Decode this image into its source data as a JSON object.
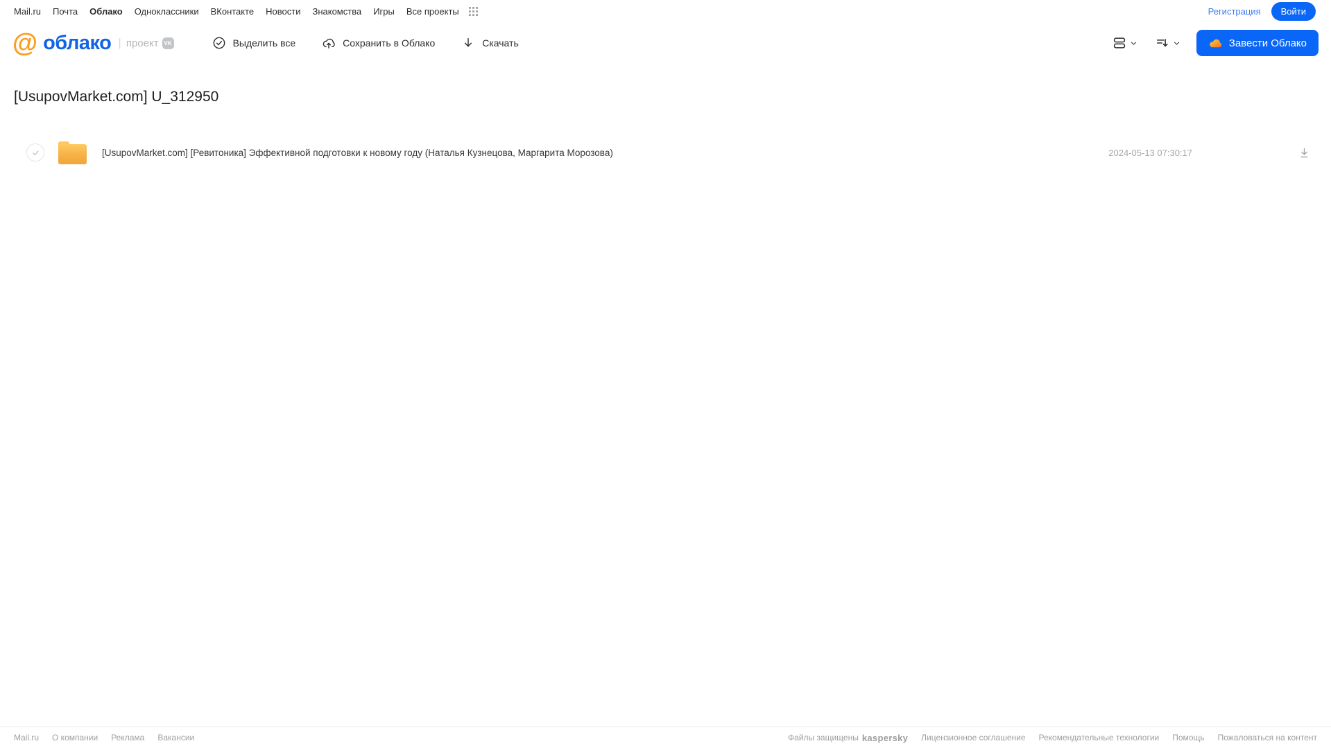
{
  "topbar": {
    "links": [
      "Mail.ru",
      "Почта",
      "Облако",
      "Одноклассники",
      "ВКонтакте",
      "Новости",
      "Знакомства",
      "Игры",
      "Все проекты"
    ],
    "active_link": "Облако",
    "register": "Регистрация",
    "login": "Войти"
  },
  "header": {
    "at_symbol": "@",
    "brand": "облако",
    "project_label": "проект",
    "vk_badge": "VK",
    "actions": [
      {
        "label": "Выделить все",
        "icon": "check-circle-icon"
      },
      {
        "label": "Сохранить в Облако",
        "icon": "cloud-upload-icon"
      },
      {
        "label": "Скачать",
        "icon": "download-icon"
      }
    ],
    "get_cloud": "Завести Облако"
  },
  "main": {
    "title": "[UsupovMarket.com] U_312950",
    "files": [
      {
        "type": "folder",
        "name": "[UsupovMarket.com] [Ревитоника] Эффективной подготовки к новому году (Наталья Кузнецова, Маргарита Морозова)",
        "date": "2024-05-13 07:30:17"
      }
    ]
  },
  "footer": {
    "left_links": [
      "Mail.ru",
      "О компании",
      "Реклама",
      "Вакансии"
    ],
    "protected_label": "Файлы защищены",
    "kaspersky_label": "kaspersky",
    "right_links": [
      "Лицензионное соглашение",
      "Рекомендательные технологии",
      "Помощь",
      "Пожаловаться на контент"
    ]
  },
  "colors": {
    "accent_blue": "#0a66f6",
    "brand_blue": "#1263e5",
    "brand_orange": "#fb9d1c",
    "folder_yellow": "#f0a63b",
    "kaspersky_green": "#00a88e"
  }
}
